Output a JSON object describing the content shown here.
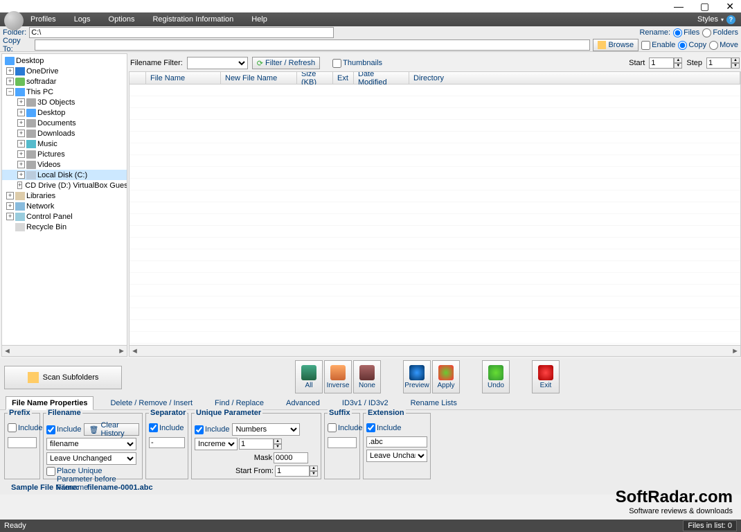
{
  "menu": {
    "profiles": "Profiles",
    "logs": "Logs",
    "options": "Options",
    "reginfo": "Registration Information",
    "help": "Help",
    "styles": "Styles"
  },
  "toolbar": {
    "folder_label": "Folder:",
    "folder_value": "C:\\",
    "rename_label": "Rename:",
    "files": "Files",
    "folders": "Folders",
    "copyto_label": "Copy To:",
    "browse": "Browse",
    "enable": "Enable",
    "copy": "Copy",
    "move": "Move"
  },
  "filter": {
    "label": "Filename Filter:",
    "btn": "Filter / Refresh",
    "thumbs": "Thumbnails",
    "start_label": "Start",
    "start_value": "1",
    "step_label": "Step",
    "step_value": "1"
  },
  "tree": {
    "desktop": "Desktop",
    "onedrive": "OneDrive",
    "softradar": "softradar",
    "thispc": "This PC",
    "obj3d": "3D Objects",
    "desk2": "Desktop",
    "docs": "Documents",
    "downloads": "Downloads",
    "music": "Music",
    "pics": "Pictures",
    "videos": "Videos",
    "disk": "Local Disk (C:)",
    "cd": "CD Drive (D:) VirtualBox Guest",
    "libraries": "Libraries",
    "network": "Network",
    "cpanel": "Control Panel",
    "bin": "Recycle Bin"
  },
  "grid": {
    "c1": "File Name",
    "c2": "New File Name",
    "c3": "Size (KB)",
    "c4": "Ext",
    "c5": "Date Modified",
    "c6": "Directory"
  },
  "scan": "Scan Subfolders",
  "big": {
    "all": "All",
    "inverse": "Inverse",
    "none": "None",
    "preview": "Preview",
    "apply": "Apply",
    "undo": "Undo",
    "exit": "Exit"
  },
  "tabs": {
    "t1": "File Name Properties",
    "t2": "Delete / Remove / Insert",
    "t3": "Find / Replace",
    "t4": "Advanced",
    "t5": "ID3v1 / ID3v2",
    "t6": "Rename Lists"
  },
  "props": {
    "prefix": "Prefix",
    "filename": "Filename",
    "separator": "Separator",
    "unique": "Unique Parameter",
    "suffix": "Suffix",
    "extension": "Extension",
    "include": "Include",
    "clearhist": "Clear History",
    "filename_val": "filename",
    "unchanged": "Leave Unchanged",
    "place_unique": "Place Unique Parameter before Filename",
    "sep_val": "-",
    "numbers": "Numbers",
    "increment": "Increment",
    "inc_val": "1",
    "mask_label": "Mask",
    "mask_val": "0000",
    "startfrom_label": "Start From:",
    "startfrom_val": "1",
    "ext_val": ".abc"
  },
  "sample": {
    "label": "Sample File Name:",
    "value": "filename-0001.abc"
  },
  "status": {
    "ready": "Ready",
    "files": "Files in list: 0"
  },
  "watermark": {
    "big": "SoftRadar.com",
    "small": "Software reviews & downloads"
  }
}
